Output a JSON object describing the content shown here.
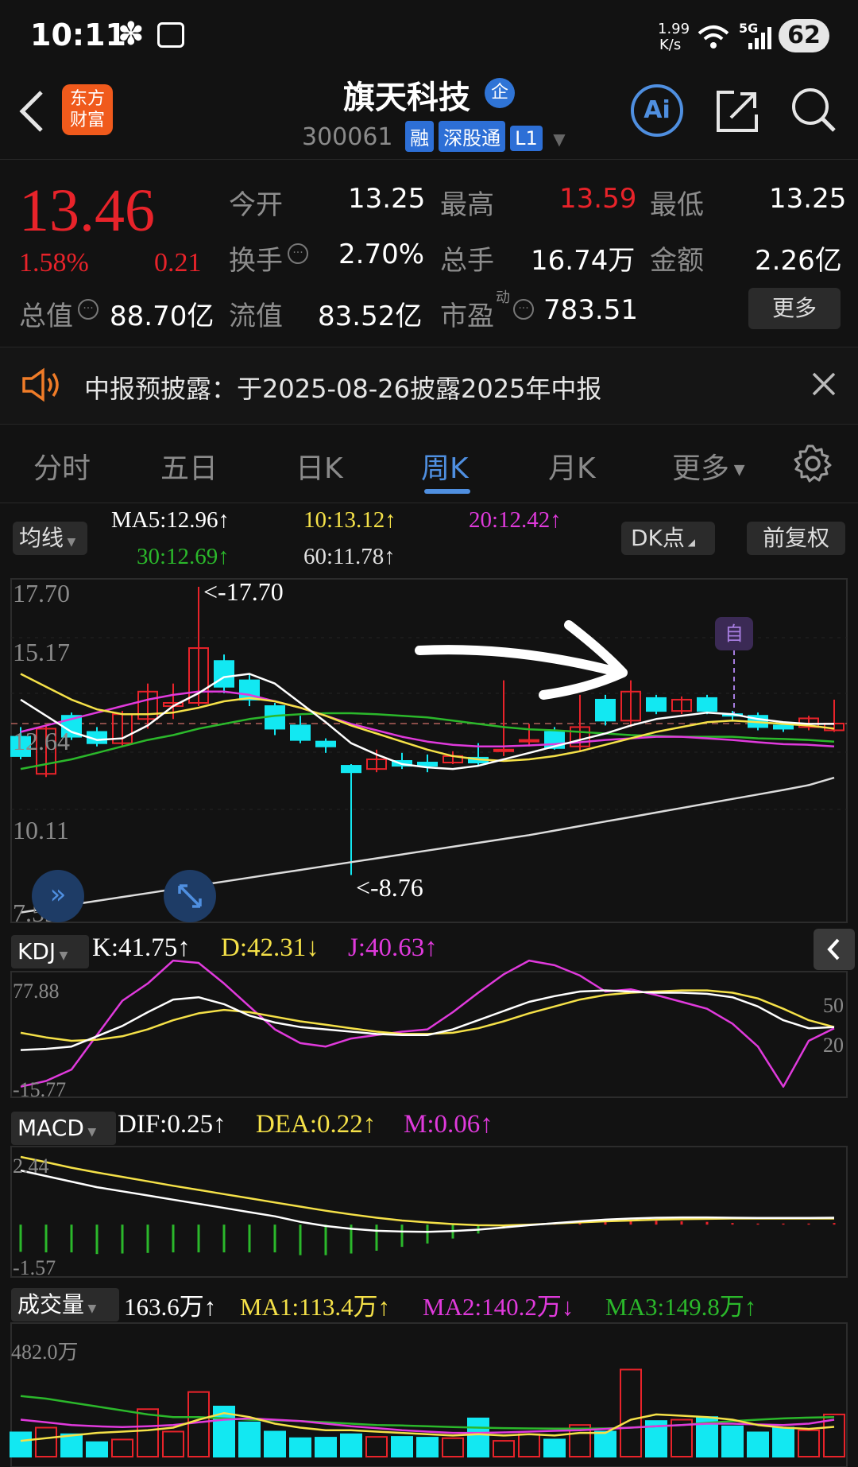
{
  "status_bar": {
    "time": "10:11",
    "net_speed_value": "1.99",
    "net_speed_unit": "K/s",
    "battery": "62",
    "signal": "5G",
    "flower_icon": "✽"
  },
  "header": {
    "back_icon": "chevron-left",
    "logo_line1": "东方",
    "logo_line2": "财富",
    "title": "旗天科技",
    "badge": "企",
    "code": "300061",
    "tags": [
      "融",
      "深股通",
      "L1"
    ],
    "ai_label": "Ai"
  },
  "quote": {
    "price": "13.46",
    "change_pct": "1.58%",
    "change": "0.21",
    "open_label": "今开",
    "open": "13.25",
    "high_label": "最高",
    "high": "13.59",
    "low_label": "最低",
    "low": "13.25",
    "turnover_label": "换手",
    "turnover": "2.70%",
    "volume_label": "总手",
    "volume": "16.74万",
    "amount_label": "金额",
    "amount": "2.26亿",
    "total_cap_label": "总值",
    "total_cap": "88.70亿",
    "float_cap_label": "流值",
    "float_cap": "83.52亿",
    "pe_label": "市盈",
    "pe_sup": "动",
    "pe": "783.51",
    "more_label": "更多"
  },
  "notice": {
    "text": "中报预披露：于2025-08-26披露2025年中报"
  },
  "tabs": [
    {
      "label": "分时",
      "active": false
    },
    {
      "label": "五日",
      "active": false
    },
    {
      "label": "日K",
      "active": false
    },
    {
      "label": "周K",
      "active": true
    },
    {
      "label": "月K",
      "active": false
    },
    {
      "label": "更多",
      "active": false
    }
  ],
  "ma_bar": {
    "selector": "均线",
    "ma5": "MA5:12.96↑",
    "ma10": "10:13.12↑",
    "ma20": "20:12.42↑",
    "ma30": "30:12.69↑",
    "ma60": "60:11.78↑",
    "dk_label": "DK点",
    "adj_label": "前复权"
  },
  "kchart": {
    "y_labels": [
      "17.70",
      "15.17",
      "12.64",
      "10.11",
      "7.59"
    ],
    "max_note": "<-17.70",
    "min_note": "<-8.76",
    "self_marker": "自"
  },
  "kdj": {
    "selector": "KDJ",
    "k": "K:41.75↑",
    "d": "D:42.31↓",
    "j": "J:40.63↑",
    "y_top": "77.88",
    "y_bottom": "-15.77",
    "right_top": "50",
    "right_bottom": "20"
  },
  "macd": {
    "selector": "MACD",
    "dif": "DIF:0.25↑",
    "dea": "DEA:0.22↑",
    "m": "M:0.06↑",
    "y_top": "2.44",
    "y_bottom": "-1.57"
  },
  "vol": {
    "selector": "成交量",
    "value": "163.6万↑",
    "ma1": "MA1:113.4万↑",
    "ma2": "MA2:140.2万↓",
    "ma3": "MA3:149.8万↑",
    "y_top": "482.0万"
  },
  "colors": {
    "up": "#e8232a",
    "down": "#12e8f2",
    "ma5": "#ffffff",
    "ma10": "#f5e148",
    "ma20": "#e03adc",
    "ma30": "#2bb82b",
    "ma60": "#dcdcdc",
    "accent": "#4f8fe0"
  },
  "chart_data": {
    "type": "candlestick",
    "ylim": [
      7.59,
      17.7
    ],
    "candles": [
      [
        13.05,
        12.45,
        13.35,
        12.35
      ],
      [
        11.9,
        13.3,
        13.4,
        11.8
      ],
      [
        13.7,
        13.05,
        13.8,
        12.95
      ],
      [
        13.2,
        12.85,
        13.35,
        12.75
      ],
      [
        12.85,
        13.75,
        13.85,
        12.75
      ],
      [
        13.6,
        14.45,
        14.7,
        13.3
      ],
      [
        14.0,
        14.1,
        14.7,
        13.6
      ],
      [
        14.1,
        15.8,
        17.7,
        14.0
      ],
      [
        15.4,
        14.6,
        15.6,
        14.4
      ],
      [
        14.8,
        14.2,
        15.0,
        14.0
      ],
      [
        14.0,
        13.3,
        14.1,
        13.1
      ],
      [
        13.4,
        12.95,
        13.7,
        12.85
      ],
      [
        12.9,
        12.75,
        13.0,
        12.55
      ],
      [
        12.15,
        11.95,
        12.2,
        8.76
      ],
      [
        12.05,
        12.35,
        12.65,
        11.95
      ],
      [
        12.3,
        12.15,
        12.55,
        12.05
      ],
      [
        12.25,
        12.15,
        12.5,
        11.95
      ],
      [
        12.25,
        12.45,
        12.6,
        12.2
      ],
      [
        12.4,
        12.25,
        12.85,
        12.15
      ],
      [
        12.65,
        12.65,
        14.8,
        12.45
      ],
      [
        12.95,
        12.95,
        13.45,
        12.75
      ],
      [
        13.2,
        12.7,
        13.35,
        12.65
      ],
      [
        12.75,
        13.35,
        14.35,
        12.6
      ],
      [
        14.2,
        13.55,
        14.35,
        13.4
      ],
      [
        13.55,
        14.45,
        14.8,
        13.35
      ],
      [
        14.25,
        13.85,
        14.35,
        13.75
      ],
      [
        13.85,
        14.2,
        14.3,
        13.75
      ],
      [
        14.25,
        13.85,
        14.35,
        13.75
      ],
      [
        13.75,
        13.72,
        13.85,
        13.55
      ],
      [
        13.7,
        13.35,
        13.8,
        13.25
      ],
      [
        13.4,
        13.3,
        13.5,
        13.2
      ],
      [
        13.35,
        13.62,
        13.7,
        13.25
      ],
      [
        13.25,
        13.46,
        14.2,
        13.2
      ]
    ],
    "ma5": [
      14.2,
      13.7,
      13.2,
      12.95,
      13.0,
      13.4,
      14.0,
      14.4,
      14.9,
      15.0,
      14.7,
      14.1,
      13.5,
      12.85,
      12.5,
      12.2,
      12.1,
      12.05,
      12.15,
      12.35,
      12.55,
      12.75,
      12.95,
      13.15,
      13.4,
      13.6,
      13.7,
      13.8,
      13.75,
      13.6,
      13.5,
      13.45,
      13.45
    ],
    "ma10": [
      15.0,
      14.6,
      14.2,
      13.9,
      13.75,
      13.75,
      13.8,
      13.95,
      14.15,
      14.25,
      14.15,
      13.95,
      13.7,
      13.4,
      13.15,
      12.9,
      12.65,
      12.45,
      12.35,
      12.3,
      12.35,
      12.45,
      12.6,
      12.8,
      13.0,
      13.2,
      13.35,
      13.5,
      13.55,
      13.5,
      13.45,
      13.4,
      13.3
    ],
    "ma20": [
      13.2,
      13.4,
      13.6,
      13.8,
      14.0,
      14.2,
      14.35,
      14.45,
      14.45,
      14.35,
      14.15,
      13.95,
      13.7,
      13.45,
      13.25,
      13.05,
      12.9,
      12.8,
      12.75,
      12.75,
      12.78,
      12.82,
      12.88,
      12.95,
      13.0,
      13.05,
      13.05,
      13.0,
      12.95,
      12.88,
      12.82,
      12.8,
      12.75
    ],
    "ma30": [
      12.05,
      12.2,
      12.35,
      12.55,
      12.75,
      12.95,
      13.1,
      13.3,
      13.45,
      13.6,
      13.7,
      13.75,
      13.78,
      13.78,
      13.75,
      13.7,
      13.65,
      13.55,
      13.45,
      13.35,
      13.28,
      13.25,
      13.2,
      13.15,
      13.1,
      13.08,
      13.05,
      13.05,
      13.05,
      13.0,
      12.98,
      12.95,
      12.9
    ],
    "ma60": [
      7.6,
      7.72,
      7.84,
      7.96,
      8.08,
      8.2,
      8.32,
      8.44,
      8.56,
      8.68,
      8.8,
      8.92,
      9.04,
      9.16,
      9.28,
      9.4,
      9.52,
      9.64,
      9.76,
      9.88,
      10.0,
      10.14,
      10.28,
      10.42,
      10.56,
      10.7,
      10.84,
      10.98,
      11.12,
      11.26,
      11.4,
      11.55,
      11.78
    ],
    "kdj_k": [
      22,
      23,
      25,
      34,
      43,
      55,
      66,
      68,
      62,
      52,
      46,
      42,
      40,
      38,
      36,
      35,
      35,
      40,
      48,
      56,
      64,
      69,
      73,
      74,
      73,
      72,
      72,
      71,
      68,
      60,
      48,
      41,
      42
    ],
    "kdj_d": [
      37,
      33,
      30,
      31,
      34,
      40,
      48,
      54,
      57,
      55,
      51,
      47,
      44,
      41,
      38,
      36,
      36,
      37,
      41,
      47,
      54,
      60,
      66,
      70,
      72,
      73,
      74,
      74,
      72,
      67,
      58,
      48,
      42
    ],
    "kdj_j": [
      -10,
      -5,
      5,
      35,
      65,
      80,
      100,
      98,
      80,
      60,
      40,
      28,
      25,
      32,
      35,
      38,
      40,
      55,
      72,
      88,
      100,
      96,
      87,
      73,
      75,
      70,
      64,
      58,
      45,
      25,
      -10,
      30,
      41
    ],
    "macd_dif": [
      1.95,
      1.75,
      1.55,
      1.35,
      1.2,
      1.05,
      0.9,
      0.75,
      0.6,
      0.45,
      0.3,
      0.1,
      -0.05,
      -0.15,
      -0.22,
      -0.25,
      -0.26,
      -0.23,
      -0.18,
      -0.1,
      -0.02,
      0.05,
      0.12,
      0.18,
      0.22,
      0.25,
      0.26,
      0.26,
      0.25,
      0.24,
      0.24,
      0.24,
      0.25
    ],
    "macd_dea": [
      2.44,
      2.25,
      2.05,
      1.88,
      1.72,
      1.56,
      1.4,
      1.25,
      1.1,
      0.95,
      0.8,
      0.65,
      0.5,
      0.37,
      0.25,
      0.15,
      0.08,
      0.02,
      -0.02,
      -0.03,
      0.0,
      0.04,
      0.08,
      0.12,
      0.15,
      0.18,
      0.2,
      0.21,
      0.22,
      0.22,
      0.22,
      0.22,
      0.22
    ],
    "volume": [
      92,
      110,
      85,
      55,
      65,
      180,
      95,
      245,
      190,
      130,
      95,
      70,
      72,
      85,
      75,
      75,
      72,
      70,
      145,
      60,
      85,
      65,
      120,
      95,
      330,
      135,
      140,
      150,
      115,
      92,
      110,
      100,
      160
    ],
    "vol_ma1": [
      60,
      70,
      80,
      90,
      95,
      100,
      110,
      140,
      165,
      150,
      125,
      110,
      100,
      100,
      95,
      90,
      85,
      80,
      85,
      80,
      85,
      80,
      90,
      90,
      140,
      160,
      155,
      150,
      140,
      120,
      110,
      105,
      113
    ],
    "vol_ma2": [
      140,
      130,
      120,
      115,
      112,
      115,
      120,
      130,
      140,
      145,
      140,
      135,
      125,
      115,
      108,
      100,
      95,
      90,
      90,
      92,
      95,
      98,
      100,
      105,
      110,
      115,
      120,
      125,
      125,
      122,
      120,
      125,
      140
    ],
    "vol_ma3": [
      230,
      220,
      205,
      190,
      175,
      160,
      150,
      150,
      145,
      140,
      138,
      135,
      130,
      125,
      120,
      118,
      115,
      112,
      110,
      108,
      107,
      106,
      106,
      107,
      110,
      115,
      120,
      128,
      135,
      140,
      145,
      148,
      150
    ]
  }
}
